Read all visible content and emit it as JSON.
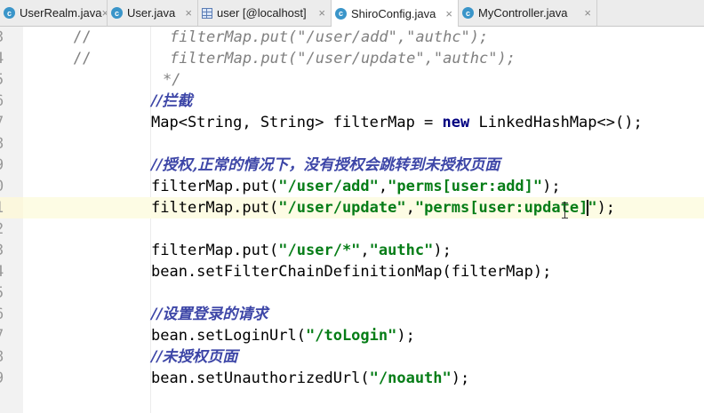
{
  "tabs": [
    {
      "name": "UserRealm.java",
      "icon": "class-icon",
      "active": false
    },
    {
      "name": "User.java",
      "icon": "class-icon",
      "active": false
    },
    {
      "name": "user [@localhost]",
      "icon": "table-icon",
      "active": false
    },
    {
      "name": "ShiroConfig.java",
      "icon": "class-icon",
      "active": true
    },
    {
      "name": "MyController.java",
      "icon": "class-icon",
      "active": false
    }
  ],
  "class_icon_letter": "c",
  "close_glyph": "×",
  "line_numbers": [
    "3",
    "4",
    "5",
    "6",
    "7",
    "8",
    "9",
    "0",
    "1",
    "2",
    "3",
    "4",
    "5",
    "6",
    "7",
    "8",
    "9"
  ],
  "code": {
    "l1": {
      "slash": "//",
      "indent": "        ",
      "call": "filterMap.put(",
      "s1": "\"/user/add\"",
      "comma": ",",
      "s2": "\"authc\"",
      "end": ");"
    },
    "l2": {
      "slash": "//",
      "indent": "        ",
      "call": "filterMap.put(",
      "s1": "\"/user/update\"",
      "comma": ",",
      "s2": "\"authc\"",
      "end": ");"
    },
    "l3": {
      "text": "*/"
    },
    "l4": {
      "comment": "//拦截"
    },
    "l5": {
      "before": "Map<String, String> filterMap = ",
      "kw": "new",
      "after": " LinkedHashMap<>();"
    },
    "l7": {
      "comment": "//授权,正常的情况下，没有授权会跳转到未授权页面"
    },
    "l8": {
      "call": "filterMap.put(",
      "s1": "\"/user/add\"",
      "comma": ",",
      "s2": "\"perms[user:add]\"",
      "end": ");"
    },
    "l9": {
      "call": "filterMap.put(",
      "s1": "\"/user/update\"",
      "comma": ",",
      "s2a": "\"perms[user:update]",
      "s2b": "\"",
      "end": ");"
    },
    "l11": {
      "call": "filterMap.put(",
      "s1": "\"/user/*\"",
      "comma": ",",
      "s2": "\"authc\"",
      "end": ");"
    },
    "l12": {
      "text": "bean.setFilterChainDefinitionMap(filterMap);"
    },
    "l14": {
      "comment": "//设置登录的请求"
    },
    "l15": {
      "call": "bean.setLoginUrl(",
      "s1": "\"/toLogin\"",
      "end": ");"
    },
    "l16": {
      "comment": "//未授权页面"
    },
    "l17": {
      "call": "bean.setUnauthorizedUrl(",
      "s1": "\"/noauth\"",
      "end": ");"
    }
  },
  "colors": {
    "comment": "#808080",
    "string": "#067d17",
    "keyword": "#000080",
    "doc_comment": "#3d46a7",
    "current_line": "#fdfce4"
  }
}
